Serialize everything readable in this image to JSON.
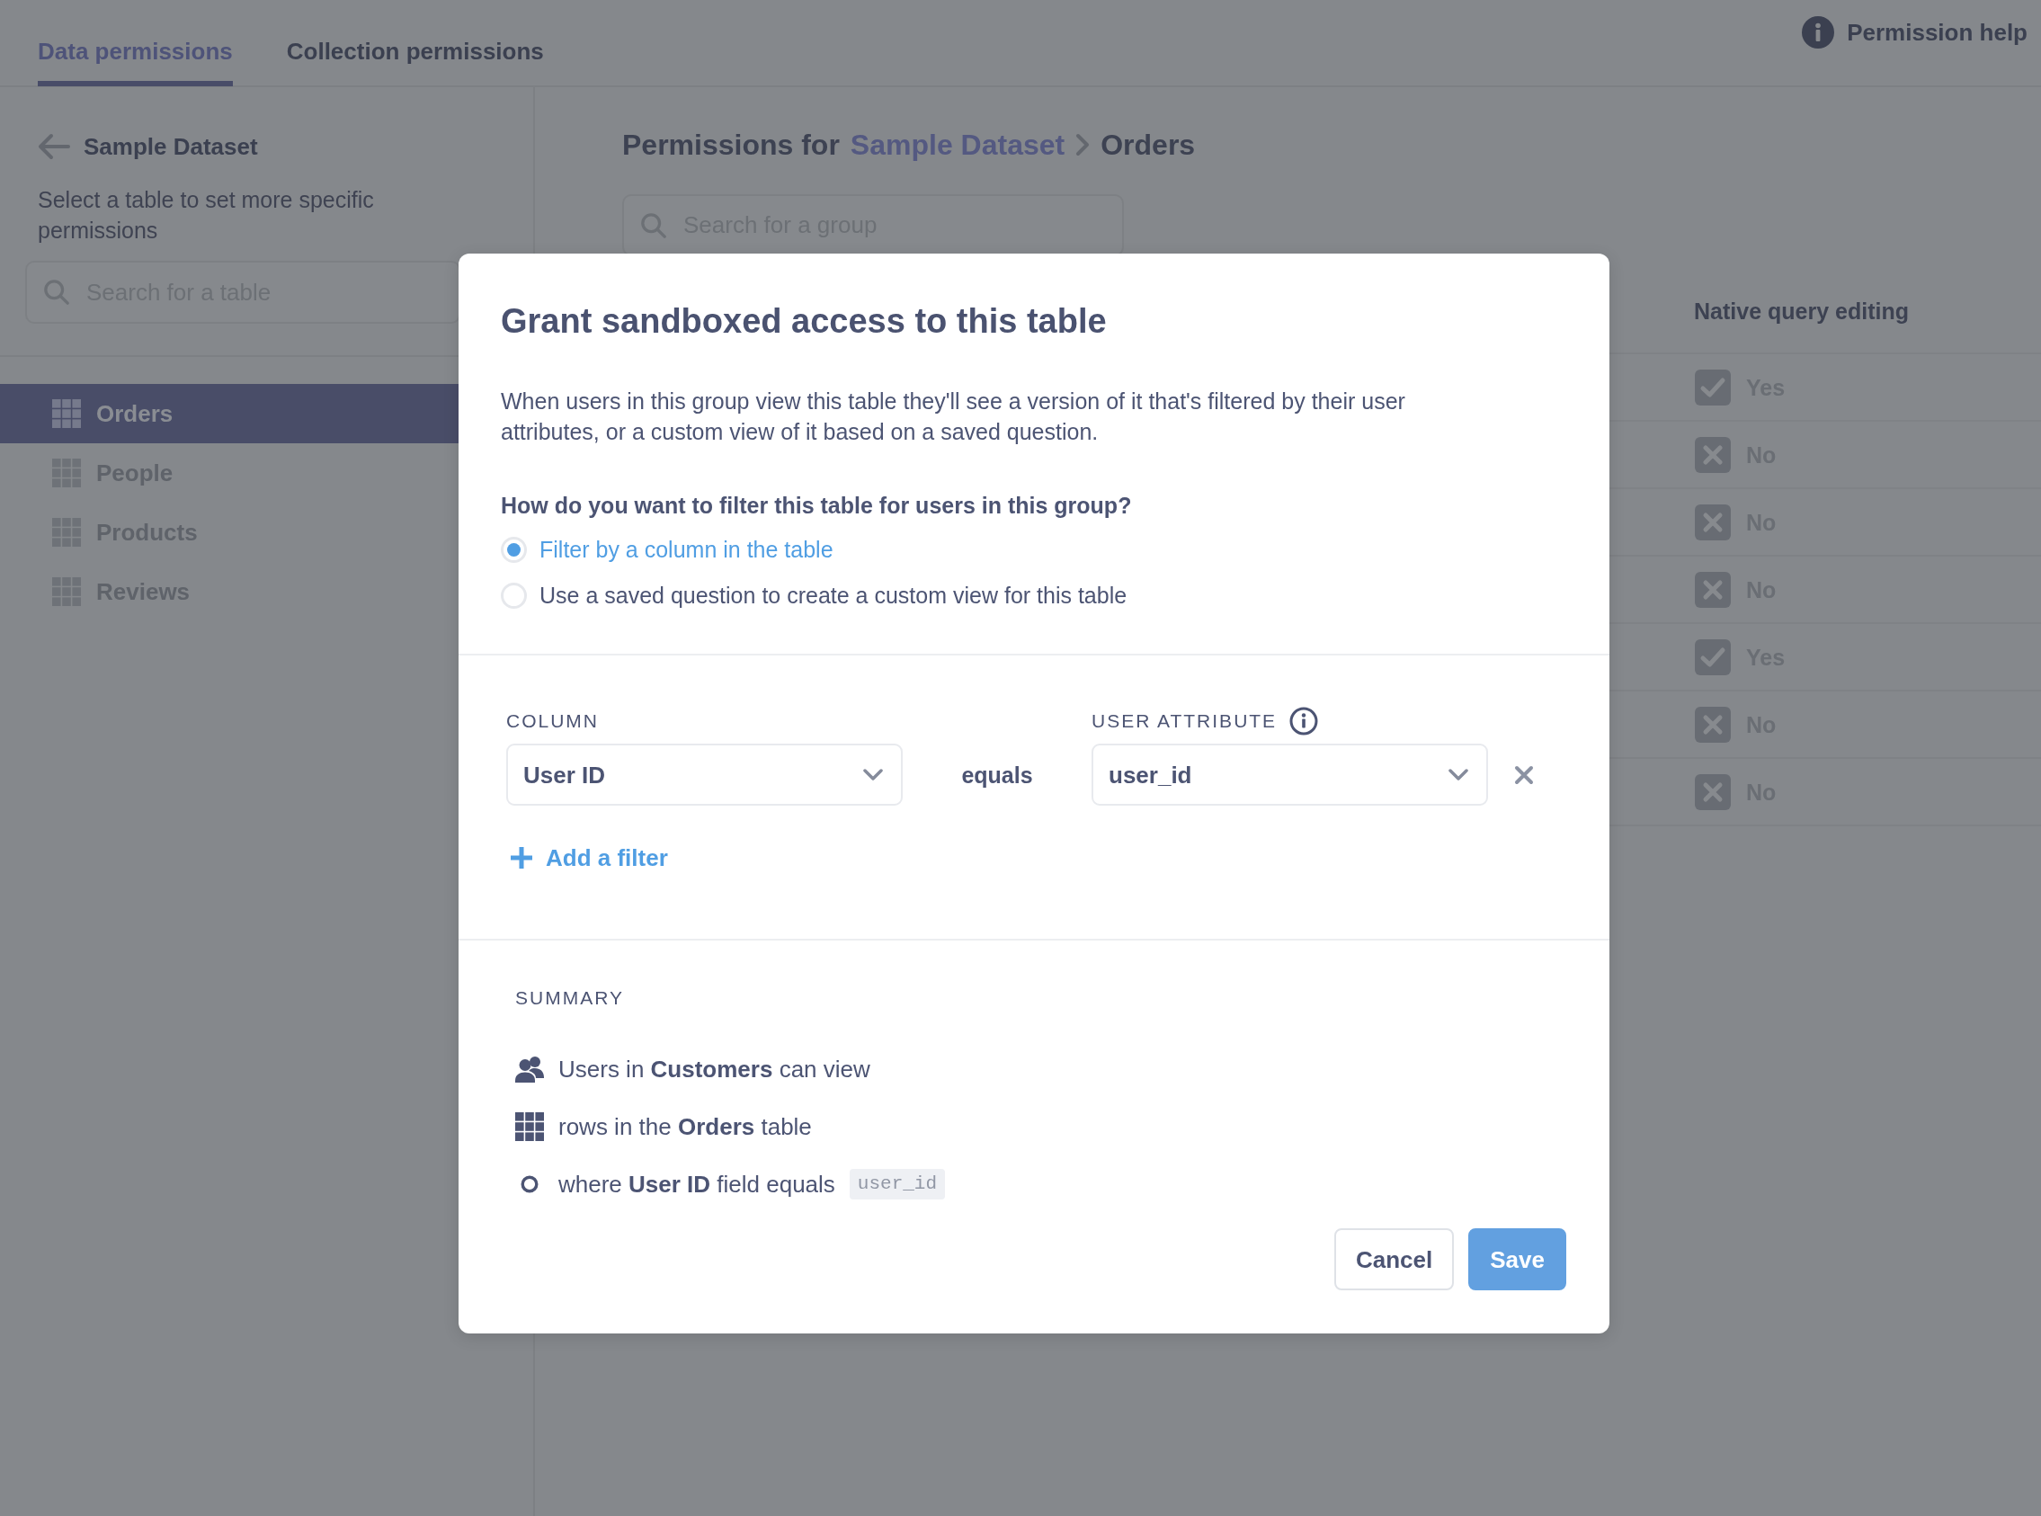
{
  "tabs": [
    {
      "label": "Data permissions",
      "selected": true
    },
    {
      "label": "Collection permissions",
      "selected": false
    }
  ],
  "help_link": {
    "label": "Permission help"
  },
  "sidebar": {
    "title": "Sample Dataset",
    "description": "Select a table to set more specific permissions",
    "search": {
      "placeholder": "Search for a table"
    },
    "items": [
      {
        "label": "Orders",
        "selected": true
      },
      {
        "label": "People",
        "selected": false
      },
      {
        "label": "Products",
        "selected": false
      },
      {
        "label": "Reviews",
        "selected": false
      }
    ]
  },
  "main": {
    "breadcrumb": {
      "prefix": "Permissions for",
      "database": "Sample Dataset",
      "table": "Orders"
    },
    "search": {
      "placeholder": "Search for a group"
    },
    "column": {
      "header": "Native query editing",
      "cells": [
        {
          "label": "Yes",
          "allowed": true
        },
        {
          "label": "No",
          "allowed": false
        },
        {
          "label": "No",
          "allowed": false
        },
        {
          "label": "No",
          "allowed": false
        },
        {
          "label": "Yes",
          "allowed": true
        },
        {
          "label": "No",
          "allowed": false
        },
        {
          "label": "No",
          "allowed": false
        }
      ]
    }
  },
  "modal": {
    "title": "Grant sandboxed access to this table",
    "description": "When users in this group view this table they'll see a version of it that's filtered by their user attributes, or a custom view of it based on a saved question.",
    "question": "How do you want to filter this table for users in this group?",
    "options": [
      {
        "label": "Filter by a column in the table",
        "selected": true
      },
      {
        "label": "Use a saved question to create a custom view for this table",
        "selected": false
      }
    ],
    "filters": [
      {
        "column_label": "COLUMN",
        "column_value": "User ID",
        "operator": "equals",
        "attribute_label": "USER ATTRIBUTE",
        "attribute_value": "user_id"
      }
    ],
    "add_filter": "Add a filter",
    "summary": {
      "heading": "SUMMARY",
      "lines": [
        {
          "kind": "group",
          "text": "Users in **Customers** can view"
        },
        {
          "kind": "table",
          "text": "rows in the **Orders** table"
        },
        {
          "kind": "field",
          "text": "where **User ID** field equals",
          "code": "user_id"
        }
      ]
    },
    "buttons": [
      {
        "label": "Cancel",
        "kind": "secondary"
      },
      {
        "label": "Save",
        "kind": "primary"
      }
    ]
  }
}
